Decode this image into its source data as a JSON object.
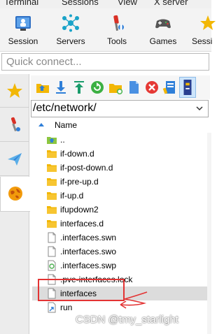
{
  "menu": {
    "items": [
      "Terminal",
      "Sessions",
      "View",
      "X server"
    ]
  },
  "ribbon": {
    "buttons": [
      {
        "label": "Session",
        "icon": "session-icon"
      },
      {
        "label": "Servers",
        "icon": "servers-icon"
      },
      {
        "label": "Tools",
        "icon": "tools-icon"
      },
      {
        "label": "Games",
        "icon": "games-icon"
      },
      {
        "label": "Sessi",
        "icon": "star-icon"
      }
    ]
  },
  "quick_connect": {
    "placeholder": "Quick connect..."
  },
  "side_tabs": [
    {
      "icon": "star-icon",
      "active": false
    },
    {
      "icon": "tools-icon",
      "active": false
    },
    {
      "icon": "send-icon",
      "active": false
    },
    {
      "icon": "sftp-globe-icon",
      "active": true
    }
  ],
  "file_toolbar": {
    "buttons": [
      "parent-folder-icon",
      "download-icon",
      "upload-icon",
      "refresh-icon",
      "new-folder-icon",
      "new-file-icon",
      "delete-icon",
      "edit-icon",
      "terminal-follow-icon"
    ]
  },
  "path": {
    "current": "/etc/network/"
  },
  "file_list": {
    "header": "Name",
    "files": [
      {
        "name": "..",
        "type": "parent"
      },
      {
        "name": "if-down.d",
        "type": "folder"
      },
      {
        "name": "if-post-down.d",
        "type": "folder"
      },
      {
        "name": "if-pre-up.d",
        "type": "folder"
      },
      {
        "name": "if-up.d",
        "type": "folder"
      },
      {
        "name": "ifupdown2",
        "type": "folder"
      },
      {
        "name": "interfaces.d",
        "type": "folder"
      },
      {
        "name": ".interfaces.swn",
        "type": "file"
      },
      {
        "name": ".interfaces.swo",
        "type": "file"
      },
      {
        "name": ".interfaces.swp",
        "type": "recycle"
      },
      {
        "name": ".pve-interfaces.lock",
        "type": "file"
      },
      {
        "name": "interfaces",
        "type": "file",
        "selected": true
      },
      {
        "name": "run",
        "type": "link"
      }
    ]
  },
  "watermark": "CSDN @tmy_starlight",
  "colors": {
    "folder": "#f2b705",
    "annotation": "#e33333",
    "selection": "#dcdcdc",
    "accent_blue": "#2f7fd8"
  }
}
